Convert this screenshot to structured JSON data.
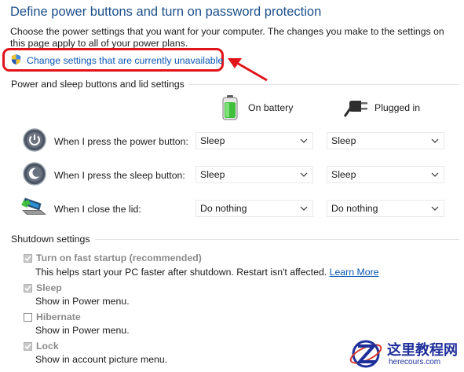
{
  "header": {
    "title": "Define power buttons and turn on password protection",
    "intro": "Choose the power settings that you want for your computer. The changes you make to the settings on this page apply to all of your power plans.",
    "change_link": "Change settings that are currently unavailable"
  },
  "buttons_section": {
    "heading": "Power and sleep buttons and lid settings",
    "col_battery": "On battery",
    "col_plugged": "Plugged in",
    "rows": [
      {
        "label": "When I press the power button:",
        "battery": "Sleep",
        "plugged": "Sleep"
      },
      {
        "label": "When I press the sleep button:",
        "battery": "Sleep",
        "plugged": "Sleep"
      },
      {
        "label": "When I close the lid:",
        "battery": "Do nothing",
        "plugged": "Do nothing"
      }
    ]
  },
  "shutdown_section": {
    "heading": "Shutdown settings",
    "items": [
      {
        "label": "Turn on fast startup (recommended)",
        "checked": true,
        "disabled": true,
        "desc": "This helps start your PC faster after shutdown. Restart isn't affected.",
        "link": "Learn More"
      },
      {
        "label": "Sleep",
        "checked": true,
        "disabled": true,
        "desc": "Show in Power menu."
      },
      {
        "label": "Hibernate",
        "checked": false,
        "disabled": true,
        "desc": "Show in Power menu."
      },
      {
        "label": "Lock",
        "checked": true,
        "disabled": true,
        "desc": "Show in account picture menu."
      }
    ]
  },
  "watermark": {
    "text": "这里教程网",
    "url": "herecours.com"
  },
  "colors": {
    "title": "#1c4f8a",
    "link": "#0a57b4",
    "highlight": "#e0141a",
    "watermark": "#1f2f9a"
  }
}
